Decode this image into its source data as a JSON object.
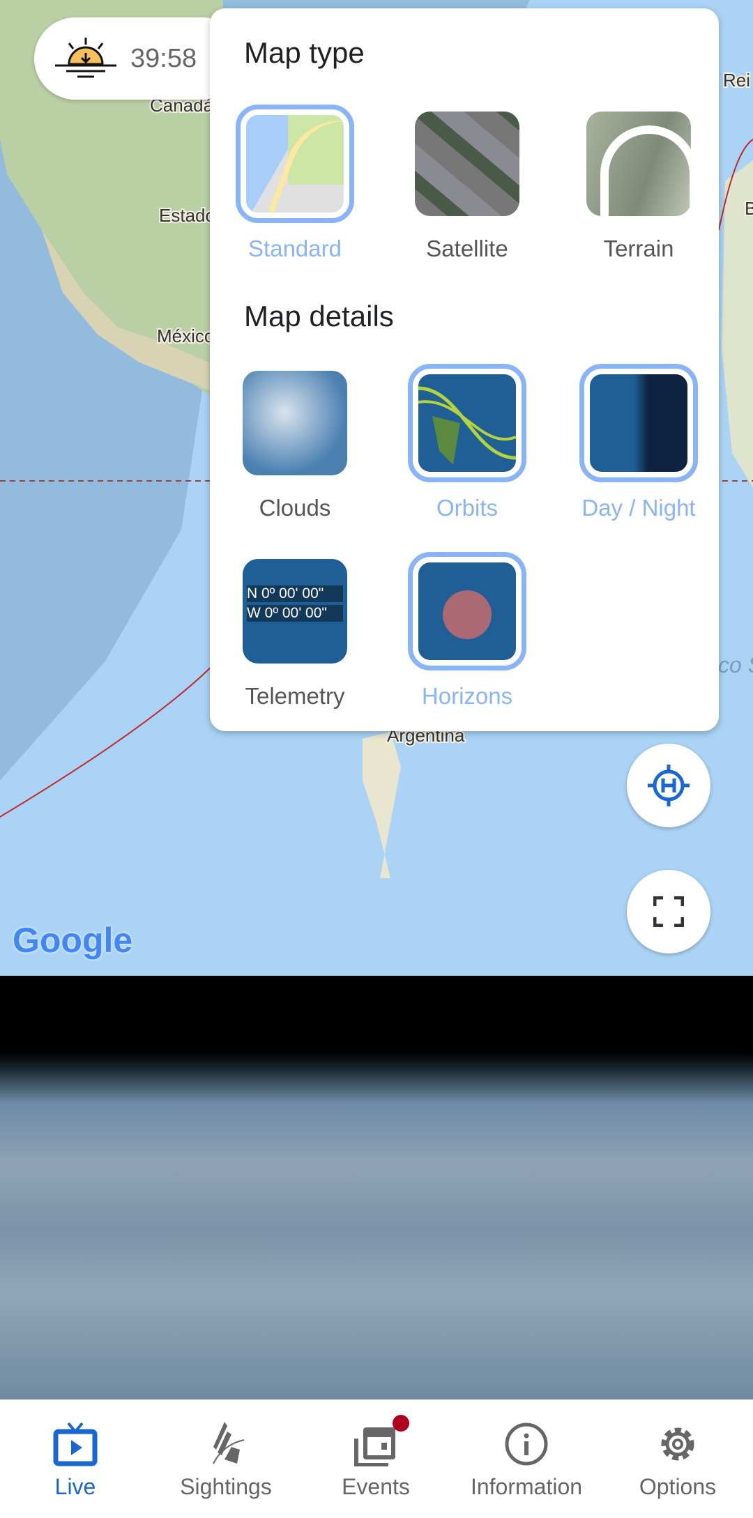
{
  "countdown": {
    "icon": "sunset-icon",
    "time": "39:58"
  },
  "map": {
    "labels": [
      "Canadá",
      "Estados Unidos",
      "México",
      "Argentina",
      "Rei",
      "B",
      "co S"
    ],
    "attribution": "Google"
  },
  "panel": {
    "map_type_title": "Map type",
    "map_types": [
      {
        "label": "Standard",
        "selected": true
      },
      {
        "label": "Satellite",
        "selected": false
      },
      {
        "label": "Terrain",
        "selected": false
      }
    ],
    "map_details_title": "Map details",
    "map_details": [
      {
        "label": "Clouds",
        "selected": false
      },
      {
        "label": "Orbits",
        "selected": true
      },
      {
        "label": "Day / Night",
        "selected": true
      },
      {
        "label": "Telemetry",
        "selected": false,
        "overlay": [
          "N 0º 00' 00\"",
          "W 0º 00' 00\""
        ]
      },
      {
        "label": "Horizons",
        "selected": true
      }
    ]
  },
  "buttons": {
    "locate": "locate-station-icon",
    "fullscreen": "fullscreen-icon"
  },
  "nav": [
    {
      "label": "Live",
      "active": true
    },
    {
      "label": "Sightings"
    },
    {
      "label": "Events",
      "badge": true
    },
    {
      "label": "Information"
    },
    {
      "label": "Options"
    }
  ],
  "colors": {
    "accent": "#1967d2",
    "selected": "#8ab4f8",
    "badge": "#b00020",
    "orbit": "#c62828"
  }
}
